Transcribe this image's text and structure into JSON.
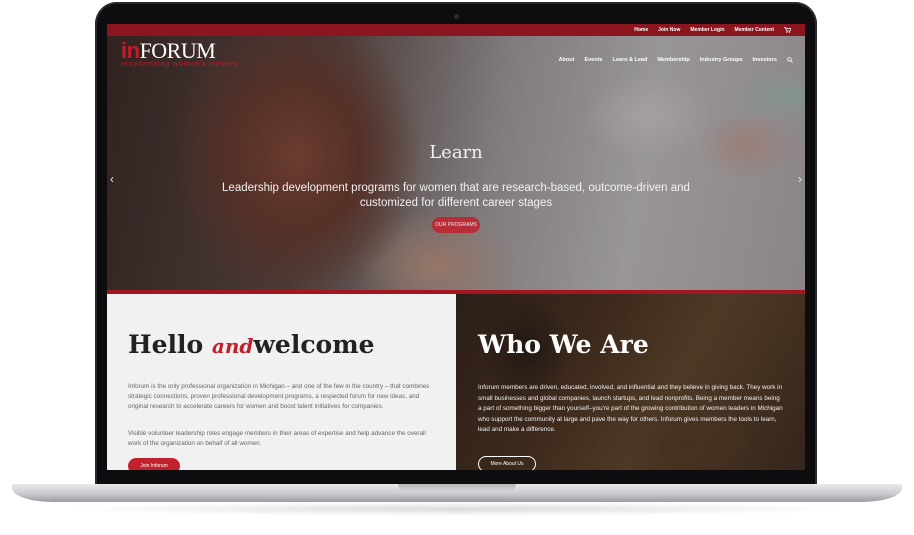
{
  "topbar": {
    "links": [
      "Home",
      "Join Now",
      "Member Login",
      "Member Content"
    ]
  },
  "logo": {
    "prefix": "in",
    "name": "FORUM",
    "tagline": "accelerating women's careers"
  },
  "nav": {
    "items": [
      "About",
      "Events",
      "Learn & Lead",
      "Membership",
      "Industry Groups",
      "Investors"
    ]
  },
  "hero": {
    "title": "Learn",
    "subtitle": "Leadership development programs for women that are research-based, outcome-driven and customized for different career stages",
    "button": "OUR PROGRAMS"
  },
  "welcome": {
    "title_start": "Hello ",
    "title_and": "and",
    "title_end": "welcome",
    "p1": "Inforum is the only professional organization in Michigan – and one of the few in the country – that combines strategic connections, proven professional development programs, a respected forum for new ideas, and original research to accelerate careers for women and boost talent initiatives for companies.",
    "p2": "Visible volunteer leadership roles engage members in their areas of expertise and help advance the overall work of the organization on behalf of all women.",
    "button": "Join Inforum"
  },
  "who": {
    "title": "Who We Are",
    "text": "Inforum members are driven, educated, involved, and influential and they believe in giving back. They work in small businesses and global companies, launch startups, and lead nonprofits. Being a member means being a part of something bigger than yourself–you're part of the growing contribution of women leaders in Michigan who support the community at large and pave the way for others. Inforum gives members the tools to learn, lead and make a difference.",
    "button": "More About Us"
  },
  "icons": {
    "cart": "cart-icon",
    "search": "search-icon",
    "arrow_left": "chevron-left-icon",
    "arrow_right": "chevron-right-icon"
  },
  "colors": {
    "brand_red": "#c2222f",
    "topbar": "#8c1620"
  }
}
